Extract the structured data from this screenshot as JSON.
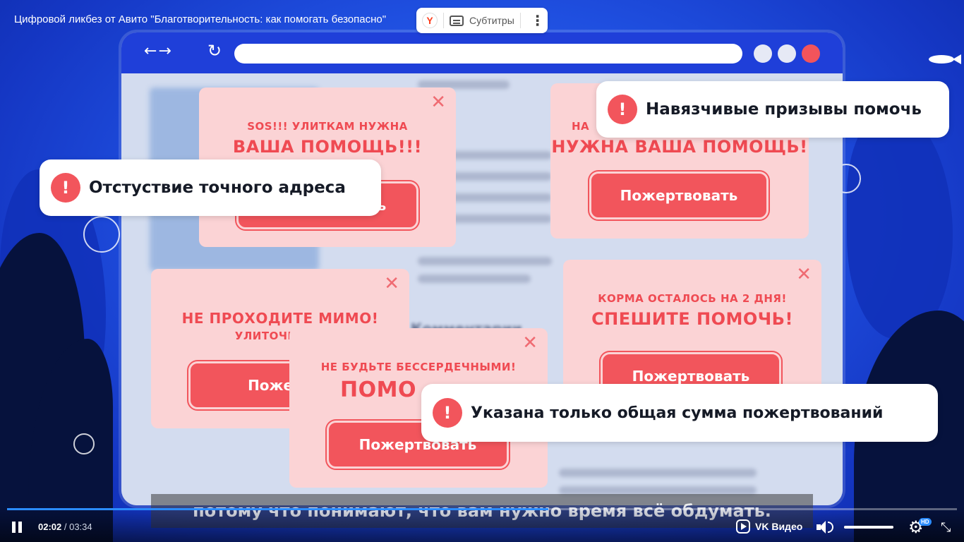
{
  "player": {
    "video_title": "Цифровой ликбез от Авито \"Благотворительность: как помогать безопасно\"",
    "yandex_logo": "Y",
    "subtitles_label": "Субтитры",
    "menu_glyph": "⋮",
    "current_time": "02:02",
    "time_separator": " / ",
    "duration": "03:34",
    "progress_fraction": 0.57,
    "volume_fraction": 1.0,
    "brand_label": "VK Видео",
    "hd_badge": "HD",
    "gear_glyph": "⚙",
    "fullscreen_glyph": "⤡",
    "accent_color": "#2b8cff"
  },
  "video_frame": {
    "subtitle_text": "потому что понимают, что вам нужно время всё обдумать.",
    "browser": {
      "nav_glyph": "←→",
      "reload_glyph": "↻",
      "blurred_heading": "Комментарии"
    },
    "popups": [
      {
        "small": "SOS!!! УЛИТКАМ НУЖНА",
        "big": "ВАША ПОМОЩЬ!!!",
        "button": "Пожертвовать",
        "close": "✕"
      },
      {
        "small": "НА",
        "big": "НУЖНА ВАША ПОМОЩЬ!",
        "button": "Пожертвовать",
        "close": "✕"
      },
      {
        "small": "УЛИТОЧКИ СТ",
        "big": "НЕ ПРОХОДИТЕ МИМО!",
        "button": "Пожерт",
        "close": "✕"
      },
      {
        "small": "КОРМА ОСТАЛОСЬ НА 2 ДНЯ!",
        "big": "СПЕШИТЕ ПОМОЧЬ!",
        "button": "Пожертвовать",
        "close": "✕"
      },
      {
        "small": "НЕ БУДЬТЕ БЕССЕРДЕЧНЫМИ!",
        "big": "ПОМО",
        "button": "Пожертвовать",
        "close": "✕"
      }
    ],
    "callouts": [
      {
        "icon_glyph": "!",
        "text": "Навязчивые призывы помочь"
      },
      {
        "icon_glyph": "!",
        "text": "Отстуствие точного адреса"
      },
      {
        "icon_glyph": "!",
        "text": "Указана только общая сумма пожертвований"
      }
    ],
    "warning_color": "#f2555c",
    "popup_color": "#fbd3d5"
  }
}
